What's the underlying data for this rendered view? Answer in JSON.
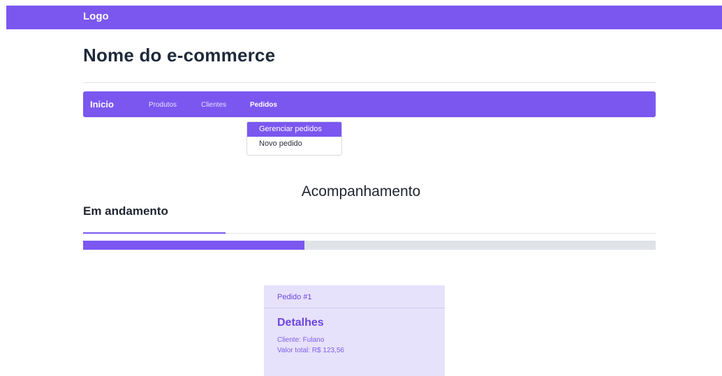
{
  "topbar": {
    "logo": "Logo"
  },
  "store": {
    "title": "Nome do e-commerce"
  },
  "nav": {
    "home": "Inicio",
    "products": "Produtos",
    "clients": "Clientes",
    "orders": "Pedidos"
  },
  "dropdown": {
    "items": [
      {
        "label": "Gerenciar pedidos",
        "active": true
      },
      {
        "label": "Novo pedido",
        "active": false
      }
    ]
  },
  "section": {
    "title": "Acompanhamento"
  },
  "tab": {
    "label": "Em andamento"
  },
  "progress": {
    "value_percent": 38.7
  },
  "card": {
    "header": "Pedido #1",
    "title": "Detalhes",
    "client": "Cliente: Fulano",
    "total": "Valor total: R$ 123,56"
  },
  "colors": {
    "accent": "#7b57f0",
    "card_bg": "#e7e2fb",
    "progress_track": "#e0e3e7"
  }
}
